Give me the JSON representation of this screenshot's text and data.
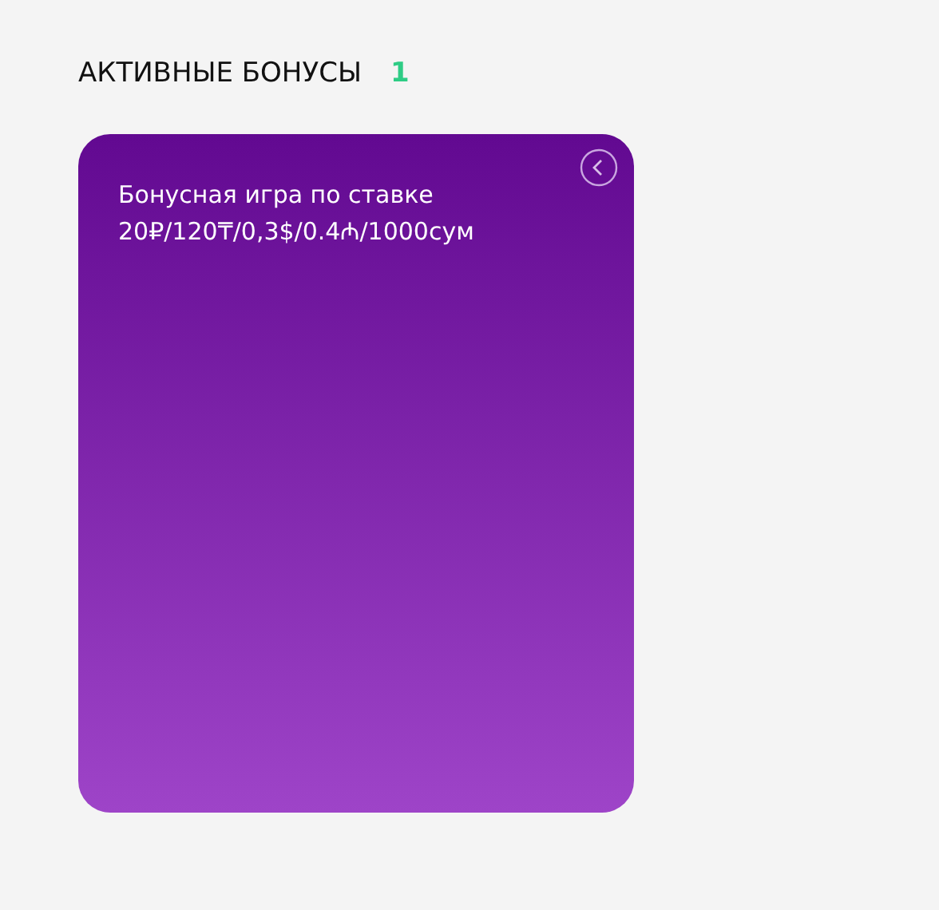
{
  "section": {
    "title": "АКТИВНЫЕ БОНУСЫ",
    "count": "1"
  },
  "bonuses": [
    {
      "text": "Бонусная игра по ставке 20₽/120₸/0,3$/0.4₼/1000сум"
    }
  ]
}
